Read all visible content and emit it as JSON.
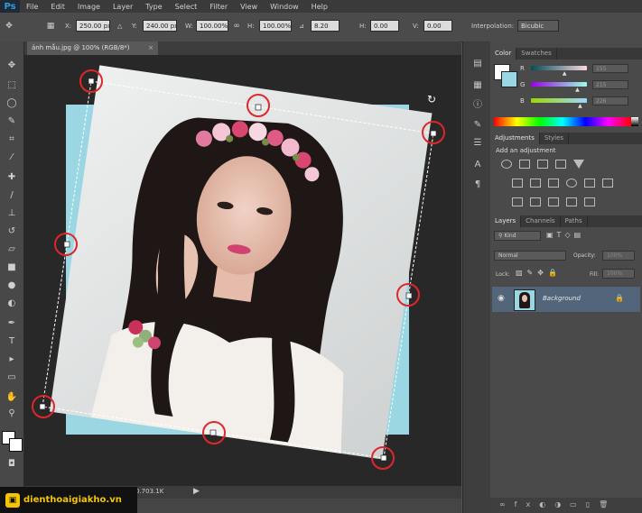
{
  "app": {
    "logo": "Ps"
  },
  "menu": [
    "File",
    "Edit",
    "Image",
    "Layer",
    "Type",
    "Select",
    "Filter",
    "View",
    "Window",
    "Help"
  ],
  "options": {
    "x_label": "X:",
    "x_value": "250.00 px",
    "y_label": "Y:",
    "y_value": "240.00 px",
    "w_label": "W:",
    "w_value": "100.00%",
    "h_label": "H:",
    "h_value": "100.00%",
    "angle_value": "8.20",
    "h_skew_label": "H:",
    "h_skew_value": "0.00",
    "v_skew_label": "V:",
    "v_skew_value": "0.00",
    "interp_label": "Interpolation:",
    "interp_value": "Bicubic"
  },
  "document": {
    "tab_title": "ảnh mẫu.jpg @ 100% (RGB/8*)",
    "close": "×",
    "status": "0.703.1K"
  },
  "color_panel": {
    "tabs": [
      "Color",
      "Swatches"
    ],
    "r_label": "R",
    "g_label": "G",
    "b_label": "B",
    "r_value": "155",
    "g_value": "215",
    "b_value": "226",
    "r_fraction": 0.61,
    "g_fraction": 0.84,
    "b_fraction": 0.89
  },
  "adjustments_panel": {
    "tabs": [
      "Adjustments",
      "Styles"
    ],
    "heading": "Add an adjustment"
  },
  "layers_panel": {
    "tabs": [
      "Layers",
      "Channels",
      "Paths"
    ],
    "kind": "Kind",
    "blend_mode": "Normal",
    "opacity_label": "Opacity:",
    "opacity_value": "100%",
    "lock_label": "Lock:",
    "fill_label": "Fill:",
    "fill_value": "100%",
    "layer_name": "Background"
  },
  "brand": {
    "text": "dienthoaigiakho.vn"
  },
  "colors": {
    "canvas_bg": "#282828",
    "photo_bg": "#9bd7e2",
    "handle_circle": "#e0262b",
    "accent": "#2e9fd9"
  }
}
